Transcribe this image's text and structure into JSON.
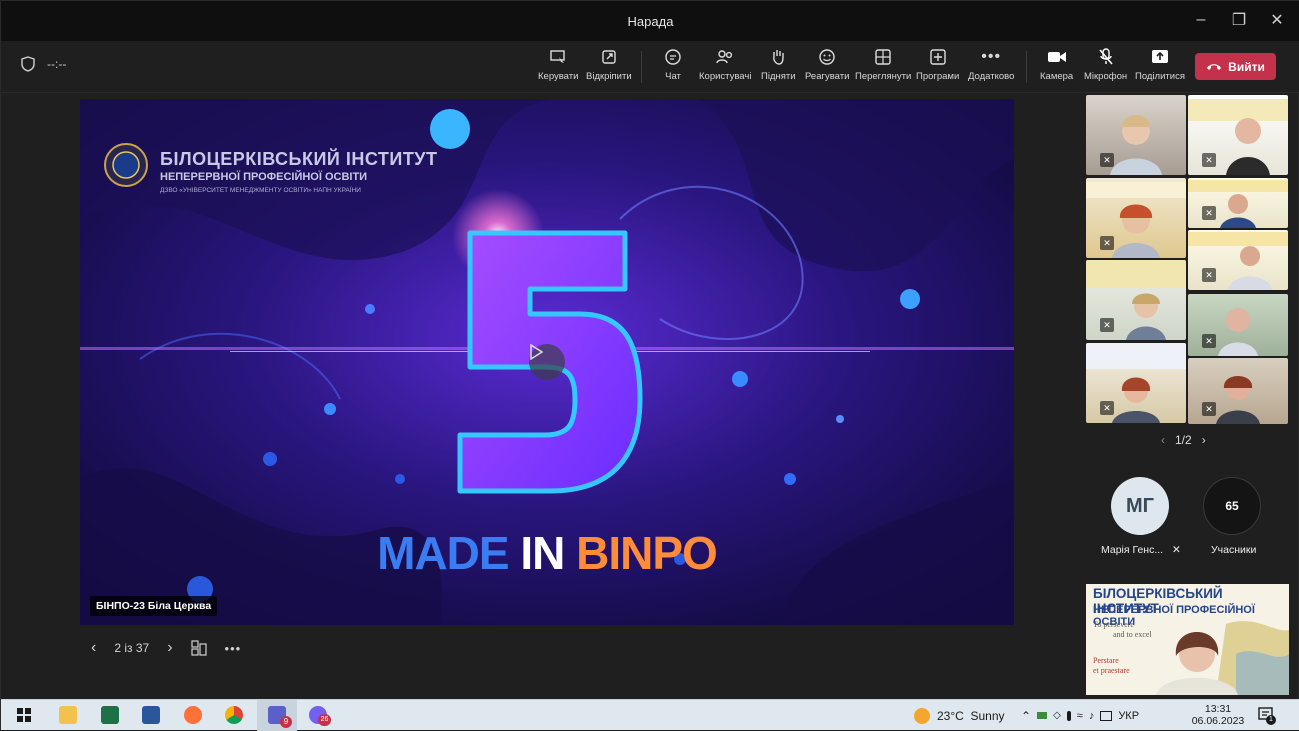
{
  "window": {
    "title": "Нарада"
  },
  "toolbar": {
    "timer": "--:--",
    "buttons": [
      {
        "label": "Керувати"
      },
      {
        "label": "Відкріпити"
      },
      {
        "label": "Чат"
      },
      {
        "label": "Користувачі"
      },
      {
        "label": "Підняти"
      },
      {
        "label": "Реагувати"
      },
      {
        "label": "Переглянути"
      },
      {
        "label": "Програми"
      },
      {
        "label": "Додатково"
      },
      {
        "label": "Камера"
      },
      {
        "label": "Мікрофон"
      },
      {
        "label": "Поділитися"
      }
    ],
    "leave_label": "Вийти",
    "leave_color": "#c4314b"
  },
  "stage": {
    "logo_line1": "БІЛОЦЕРКІВСЬКИЙ ІНСТИТУТ",
    "logo_line2": "НЕПЕРЕРВНОЇ ПРОФЕСІЙНОЇ ОСВІТИ",
    "logo_line3": "ДЗВО «УНІВЕРСИТЕТ МЕНЕДЖМЕНТУ ОСВІТИ» НАПН УКРАЇНИ",
    "big_number": "5",
    "slogan_a": "MADE",
    "slogan_b": "IN",
    "slogan_c": "BINPO",
    "presenter_label": "БІНПО-23 Біла Церква"
  },
  "slide_controls": {
    "counter": "2 із 37"
  },
  "participants": {
    "pager": "1/2",
    "avatar_initials": "МГ",
    "avatar_name": "Марія Генс...",
    "count": "65",
    "count_label": "Учасники",
    "self_view_line1": "БІЛОЦЕРКІВСЬКИЙ ІНСТИТУТ",
    "self_view_line2": "НЕПЕРЕРВНОЇ ПРОФЕСІЙНОЇ ОСВІТИ",
    "self_view_motto1": "To persevere",
    "self_view_motto2": "and to excel",
    "self_view_motto3": "Perstare",
    "self_view_motto4": "et praestare"
  },
  "taskbar": {
    "weather": "23°C  Sunny",
    "lang": "УКР",
    "time": "13:31",
    "date": "06.06.2023",
    "teams_badge": "9",
    "viber_badge": "26",
    "notif_badge": "1"
  }
}
